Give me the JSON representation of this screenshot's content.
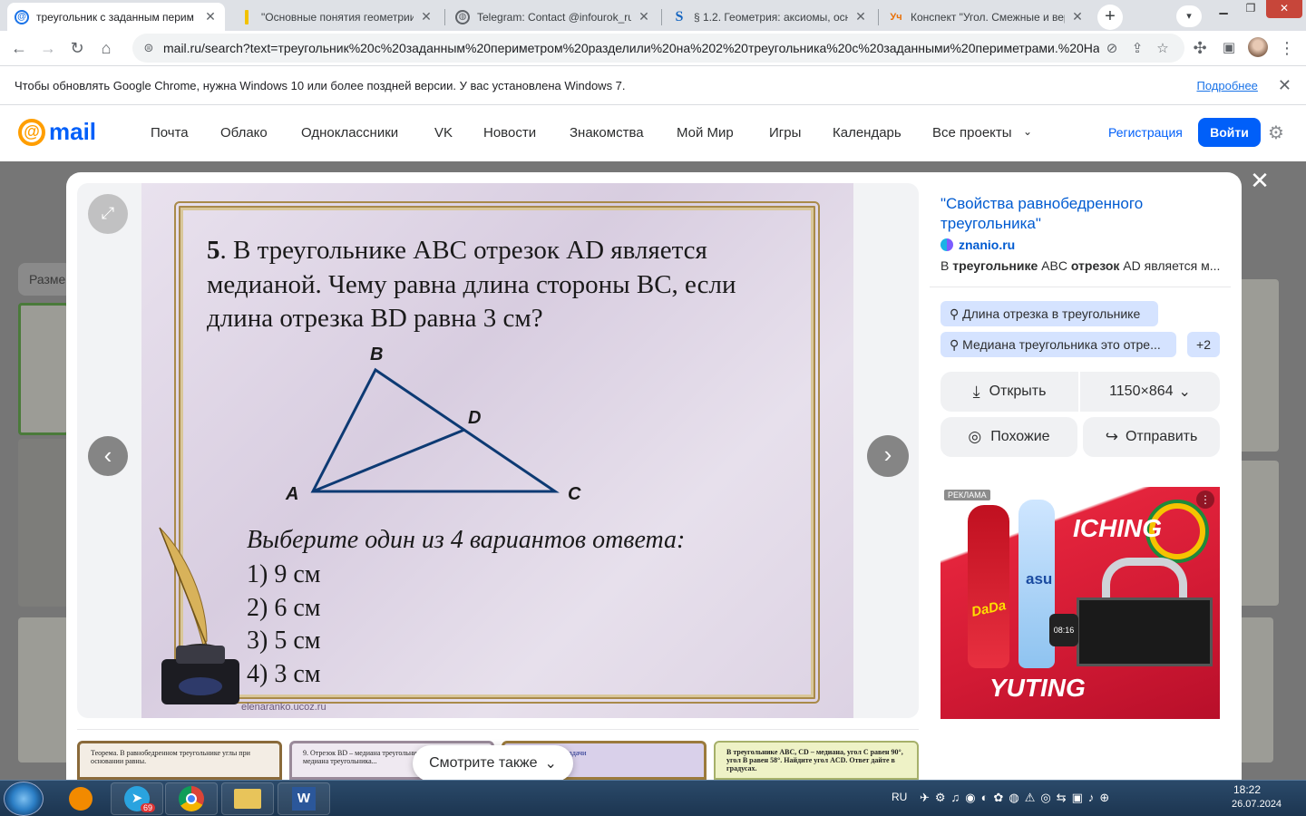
{
  "browser": {
    "tabs": [
      {
        "title": "треугольник с заданным перим",
        "icon": "mail-at-icon",
        "active": true
      },
      {
        "title": "\"Основные понятия геометрии.",
        "icon": "yellow-bar-icon",
        "active": false
      },
      {
        "title": "Telegram: Contact @infourok_ru_",
        "icon": "globe-icon",
        "active": false
      },
      {
        "title": "§ 1.2. Геометрия: аксиомы, осно",
        "icon": "s-logo-icon",
        "active": false
      },
      {
        "title": "Конспект \"Угол. Смежные и вер",
        "icon": "infourok-icon",
        "active": false
      }
    ],
    "url": "mail.ru/search?text=треугольник%20с%20заданным%20периметром%20разделили%20на%202%20треугольника%20с%20заданными%20периметрами.%20На...",
    "infobar_message": "Чтобы обновлять Google Chrome, нужна Windows 10 или более поздней версии. У вас установлена Windows 7.",
    "infobar_link": "Подробнее"
  },
  "site": {
    "logo_text": "mail",
    "nav": [
      "Почта",
      "Облако",
      "Одноклассники",
      "VK",
      "Новости",
      "Знакомства",
      "Мой Мир",
      "Игры",
      "Календарь",
      "Все проекты"
    ],
    "register": "Регистрация",
    "login": "Войти",
    "bg_size_label": "Разме"
  },
  "slide": {
    "q_num": "5",
    "line1_rest": ". В треугольнике ABC отрезок AD является",
    "line2": "медианой. Чему равна длина стороны BC, если",
    "line3": "длина отрезка BD равна 3 см?",
    "points": {
      "A": "A",
      "B": "B",
      "C": "C",
      "D": "D"
    },
    "prompt": "Выберите один из 4 вариантов ответа:",
    "options": [
      "1) 9 см",
      "2) 6 см",
      "3) 5 см",
      "4) 3 см"
    ],
    "watermark": "elenaranko.ucoz.ru"
  },
  "panel": {
    "title": "\"Свойства равнобедренного треугольника\"",
    "source": "znanio.ru",
    "snippet_bold1": "треугольнике",
    "snippet_pre": "В ",
    "snippet_mid": " ABC ",
    "snippet_bold2": "отрезок",
    "snippet_post": " AD является м...",
    "chips": [
      "Длина отрезка в треугольнике",
      "Медиана треугольника это отре...",
      "+2"
    ],
    "open": "Открыть",
    "size": "1150×864",
    "similar": "Похожие",
    "send": "Отправить",
    "ad_label": "РЕКЛАМА",
    "ad_text1": "ICHING",
    "ad_text2": "YUTING",
    "ad_bottle1": "DaDa",
    "ad_bottle2": "asu",
    "ad_watch": "08:16"
  },
  "bottom": {
    "see_also": "Смотрите также",
    "thumb1": "Теорема. В равнобедренном треугольнике углы при основании равны.",
    "thumb2": "9. Отрезок BD – медиана треугольника... отрезок BE – медиана треугольника...",
    "thumb3": "бразец решения задачи",
    "thumb4": "В треугольнике ABC, CD – медиана, угол C равен 90°, угол B равен 58°. Найдите угол ACD. Ответ дайте в градусах."
  },
  "taskbar": {
    "lang": "RU",
    "time": "18:22",
    "date": "26.07.2024",
    "telegram_badge": "69"
  },
  "colors": {
    "mail_blue": "#005ff9",
    "mail_orange": "#ff9e00",
    "chip_bg": "#d5e3ff",
    "frame_gold": "#a98a4a",
    "triangle_stroke": "#0d3a73"
  }
}
